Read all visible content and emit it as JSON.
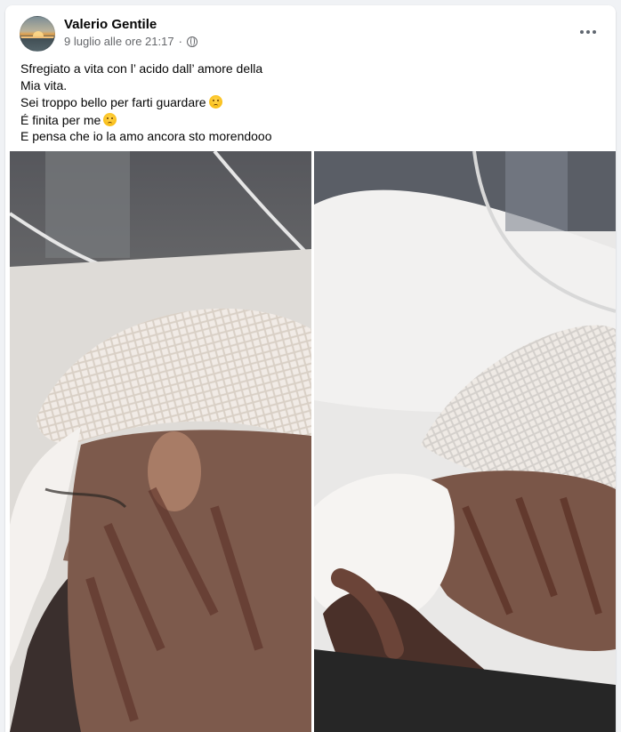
{
  "post": {
    "author": "Valerio Gentile",
    "timestamp": "9 luglio alle ore 21:17",
    "separator": "·",
    "privacy_icon": "globe-icon",
    "more_icon": "more-options-icon",
    "lines": [
      "Sfregiato a vita con l’ acido dall’ amore della",
      "Mia vita.",
      "Sei troppo bello per farti guardare",
      "É finita per me",
      "E pensa che io la amo ancora sto morendooo"
    ],
    "emoji": "sad-relieved-face-emoji"
  },
  "photos": [
    {
      "id": "left",
      "description_icon": "hospital-photo-head-bandage"
    },
    {
      "id": "right",
      "description_icon": "hospital-photo-neck-bandage"
    }
  ],
  "colors": {
    "background": "#f0f2f5",
    "card": "#ffffff",
    "text": "#050505",
    "secondary": "#65676b"
  }
}
